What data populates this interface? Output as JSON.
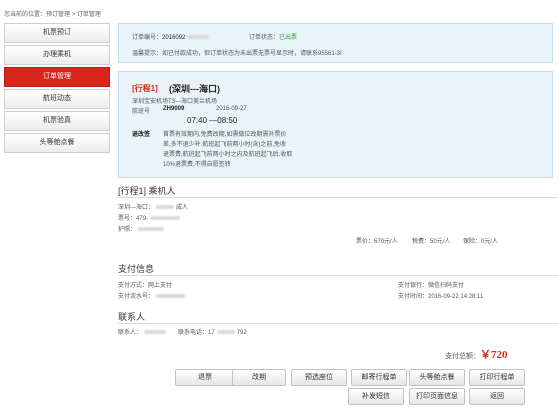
{
  "breadcrumb": "您当前的位置：预订管理 > 订单管理",
  "sidebar": {
    "items": [
      {
        "label": "机票预订"
      },
      {
        "label": "办理乘机"
      },
      {
        "label": "订单管理"
      },
      {
        "label": "航班动态"
      },
      {
        "label": "机票验真"
      },
      {
        "label": "头等舱点餐"
      }
    ]
  },
  "order": {
    "number_label": "订单编号：",
    "number_value": "2016092",
    "status_label": "订单状态：",
    "status_value": "已出票",
    "tip": "温馨提示：如已付款成功，但订单状态为未出票无票号显示时，请联系95561-3!"
  },
  "trip": {
    "tag": "[行程1]",
    "route": "(深圳---海口)",
    "airports": "深圳宝安机场T3---海口美兰机场",
    "flight_label": "航班号",
    "flight_no": "ZH9009",
    "date": "2016-09-27",
    "time": "07:40 —08:50",
    "refund_label": "退改签",
    "refund_lines": [
      "首票有效期内,免费改期,如需做位改期需补票价",
      "差,多不退少补.航班起飞前两小时(含)之前,免收",
      "退票费,航班起飞前两小时之内及航班起飞后,收取",
      "10%退票费,不得自愿签转"
    ]
  },
  "passenger": {
    "title": "[行程1]  乘机人",
    "route": "深圳---海口：",
    "type": "成人",
    "ticket_label": "票号：",
    "ticket_value": "479-",
    "id_label": "护照：",
    "price_label": "票价：",
    "price_value": "670元/人",
    "tax_label": "税费：",
    "tax_value": "50元/人",
    "insurance_label": "保险：",
    "insurance_value": "0元/人"
  },
  "payment": {
    "title": "支付信息",
    "method_label": "支付方式：",
    "method_value": "网上支付",
    "serial_label": "支付流水号：",
    "bank_label": "支付银行：",
    "bank_value": "微信扫码支付",
    "time_label": "支付时间：",
    "time_value": "2016-09-22 14:28:11"
  },
  "contact": {
    "title": "联系人",
    "name_label": "联系人：",
    "phone_label": "联系电话：",
    "phone_start": "17",
    "phone_end": "792"
  },
  "total": {
    "label": "支付总额：",
    "value": "￥720"
  },
  "buttons": {
    "refund": "退票",
    "change": "改期",
    "seat": "预选座位",
    "mail": "邮寄行程单",
    "first_meal": "头等舱点餐",
    "print_itinerary": "打印行程单",
    "reissue": "补发短信",
    "print_page": "打印页面信息",
    "back": "返回"
  },
  "colors": {
    "accent_red": "#d9261c",
    "status_green": "#22a33a",
    "panel_bg": "#eaf3f8"
  }
}
